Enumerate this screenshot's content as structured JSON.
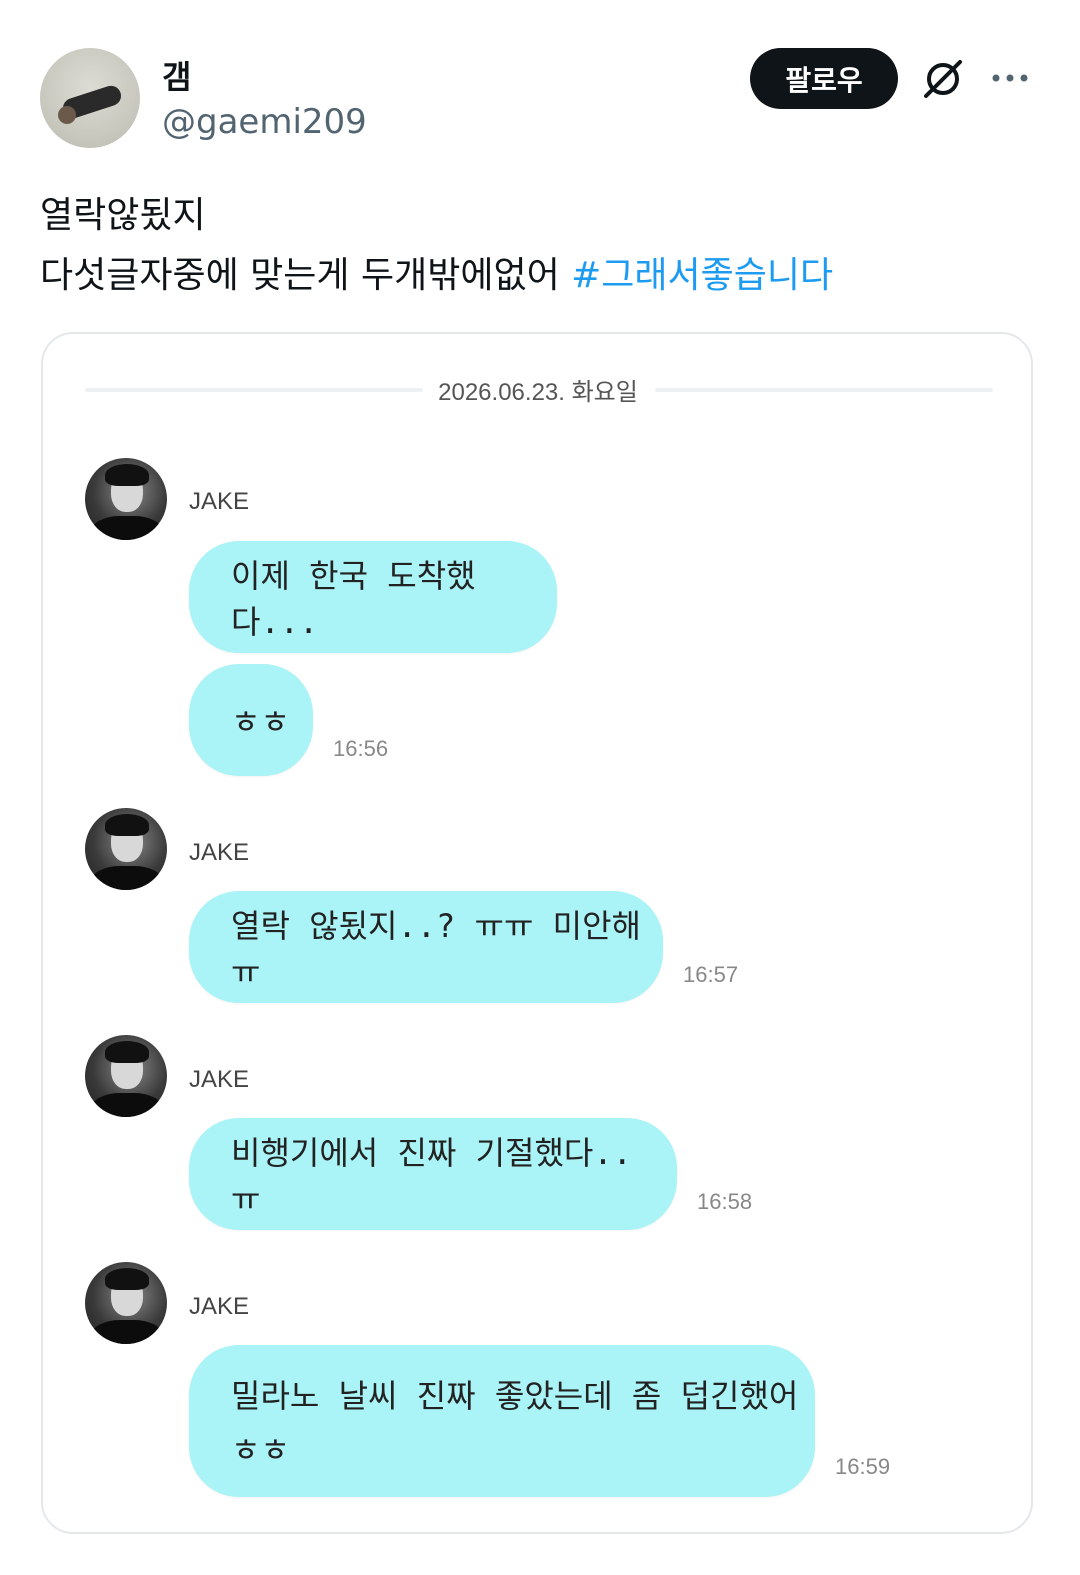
{
  "post": {
    "display_name": "갬",
    "handle": "@gaemi209",
    "follow_label": "팔로우",
    "icons": {
      "grok": "grok-icon",
      "more": "more-icon"
    },
    "text_line1": "열락않됬지",
    "text_line2": "다섯글자중에 맞는게 두개밖에없어 ",
    "hashtag": "#그래서좋습니다"
  },
  "chat": {
    "date": "2026.06.23. 화요일",
    "sender": "JAKE",
    "messages": [
      {
        "text": "이제 한국 도착했다...",
        "time": ""
      },
      {
        "text": "ㅎㅎ",
        "time": "16:56"
      },
      {
        "text": "열락 않됬지..? ㅠㅠ 미안해 ㅠ",
        "time": "16:57"
      },
      {
        "text": "비행기에서 진짜 기절했다.. ㅠ",
        "time": "16:58"
      },
      {
        "text": "밀라노 날씨 진짜 좋았는데 좀 덥긴했어\nㅎㅎ",
        "time": "16:59"
      }
    ]
  },
  "colors": {
    "bubble": "#aaf3f6",
    "hashtag": "#1d9bf0",
    "follow_bg": "#0f1419"
  }
}
